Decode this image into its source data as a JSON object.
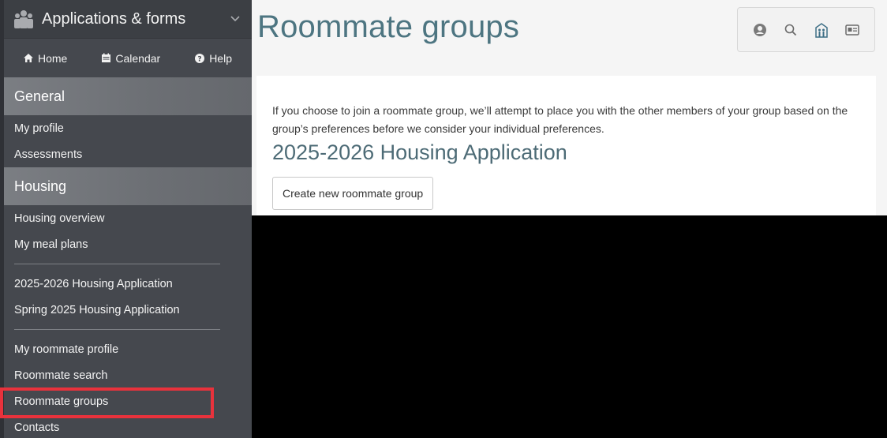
{
  "sidebar": {
    "app_title": "Applications & forms",
    "app_icon": "people-icon",
    "nav": [
      {
        "label": "Home",
        "icon": "home-icon"
      },
      {
        "label": "Calendar",
        "icon": "calendar-icon"
      },
      {
        "label": "Help",
        "icon": "help-icon"
      }
    ],
    "sections": {
      "general": {
        "title": "General",
        "items": [
          "My profile",
          "Assessments"
        ]
      },
      "housing": {
        "title": "Housing",
        "group1": [
          "Housing overview",
          "My meal plans"
        ],
        "group2": [
          "2025-2026 Housing Application",
          "Spring 2025 Housing Application"
        ],
        "group3": [
          "My roommate profile",
          "Roommate search",
          "Roommate groups",
          "Contacts"
        ]
      }
    },
    "selected_item": "Roommate groups",
    "highlight_color": "#e8323c"
  },
  "main": {
    "title": "Roommate groups",
    "toolbar_icons": [
      "user-icon",
      "search-icon",
      "building-icon",
      "card-icon"
    ],
    "intro_text": "If you choose to join a roommate group, we’ll attempt to place you with the other members of your group based on the group’s preferences before we consider your individual preferences.",
    "application_heading": "2025-2026 Housing Application",
    "create_button": "Create new roommate group"
  },
  "colors": {
    "title": "#4d7581",
    "sidebar_bg": "#45484e",
    "section_bg": "#6c6f74"
  }
}
